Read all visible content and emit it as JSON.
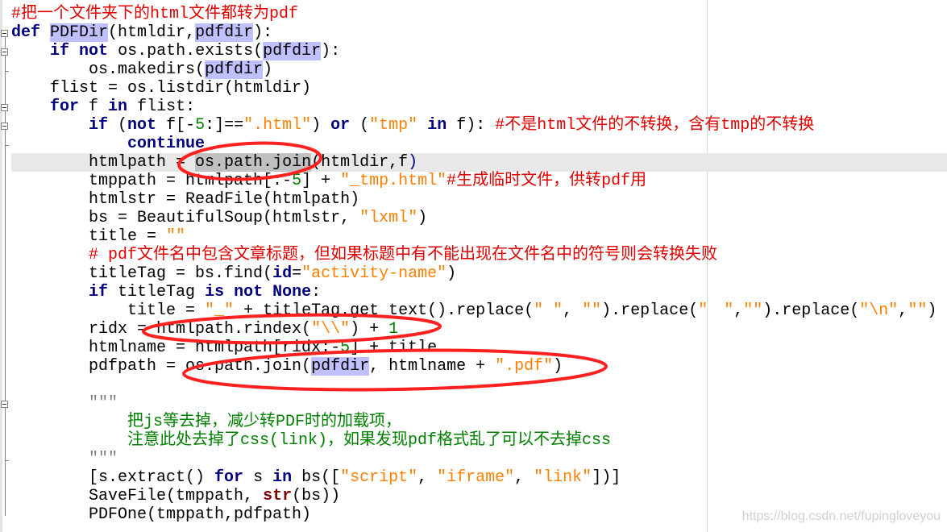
{
  "editor": {
    "current_line": 9,
    "colors": {
      "keyword": "#000080",
      "string": "#ff8000",
      "number": "#008000",
      "comment": "#e00000",
      "docstring": "#008000",
      "highlight": "#c0c0ff",
      "annotation": "#ff2020"
    },
    "lines": [
      [
        [
          "#把一个文件夹下的html文件都转为pdf",
          "c"
        ]
      ],
      [
        [
          "def",
          "k"
        ],
        [
          " ",
          ""
        ],
        [
          "PDFDir",
          "h"
        ],
        [
          "(htmldir,",
          ""
        ],
        [
          "pdfdir",
          "h"
        ],
        [
          "):",
          ""
        ]
      ],
      [
        [
          "    ",
          ""
        ],
        [
          "if",
          "k"
        ],
        [
          " ",
          ""
        ],
        [
          "not",
          "k"
        ],
        [
          " os.path.exists(",
          ""
        ],
        [
          "pdfdir",
          "h"
        ],
        [
          "):",
          ""
        ]
      ],
      [
        [
          "        os.makedirs(",
          ""
        ],
        [
          "pdfdir",
          "h"
        ],
        [
          ")",
          ""
        ]
      ],
      [
        [
          "    flist = os.listdir(htmldir)",
          ""
        ]
      ],
      [
        [
          "    ",
          ""
        ],
        [
          "for",
          "k"
        ],
        [
          " f ",
          ""
        ],
        [
          "in",
          "k"
        ],
        [
          " flist:",
          ""
        ]
      ],
      [
        [
          "        ",
          ""
        ],
        [
          "if",
          "k"
        ],
        [
          " (",
          ""
        ],
        [
          "not",
          "k"
        ],
        [
          " f[-",
          ""
        ],
        [
          "5",
          "n"
        ],
        [
          ":]==",
          ""
        ],
        [
          "\".html\"",
          "s"
        ],
        [
          ") ",
          ""
        ],
        [
          "or",
          "k"
        ],
        [
          " (",
          ""
        ],
        [
          "\"tmp\"",
          "s"
        ],
        [
          " ",
          ""
        ],
        [
          "in",
          "k"
        ],
        [
          " f): ",
          ""
        ],
        [
          "#不是html文件的不转换，含有tmp的不转换",
          "c"
        ]
      ],
      [
        [
          "            ",
          ""
        ],
        [
          "continue",
          "k"
        ]
      ],
      [
        [
          "        htmlpath = ",
          ""
        ],
        [
          "os.path.join",
          "sel"
        ],
        [
          "(htmldir,f",
          ""
        ],
        [
          ")",
          "f"
        ]
      ],
      [
        [
          "        tmppath = htmlpath[:-",
          ""
        ],
        [
          "5",
          "n"
        ],
        [
          "] + ",
          ""
        ],
        [
          "\"_tmp.html\"",
          "s"
        ],
        [
          "#生成临时文件，供转pdf用",
          "c"
        ]
      ],
      [
        [
          "        htmlstr = ReadFile(htmlpath)",
          ""
        ]
      ],
      [
        [
          "        bs = BeautifulSoup(htmlstr, ",
          ""
        ],
        [
          "\"lxml\"",
          "s"
        ],
        [
          ")",
          ""
        ]
      ],
      [
        [
          "        title = ",
          ""
        ],
        [
          "\"\"",
          "s"
        ]
      ],
      [
        [
          "        ",
          ""
        ],
        [
          "# pdf文件名中包含文章标题，但如果标题中有不能出现在文件名中的符号则会转换失败",
          "c"
        ]
      ],
      [
        [
          "        titleTag = bs.find(",
          ""
        ],
        [
          "id",
          "k"
        ],
        [
          "=",
          ""
        ],
        [
          "\"activity-name\"",
          "s"
        ],
        [
          ")",
          ""
        ]
      ],
      [
        [
          "        ",
          ""
        ],
        [
          "if",
          "k"
        ],
        [
          " titleTag ",
          ""
        ],
        [
          "is",
          "k"
        ],
        [
          " ",
          ""
        ],
        [
          "not",
          "k"
        ],
        [
          " ",
          ""
        ],
        [
          "None",
          "k"
        ],
        [
          ":",
          ""
        ]
      ],
      [
        [
          "            title = ",
          ""
        ],
        [
          "\"_\"",
          "s"
        ],
        [
          " + titleTag.get_text().replace(",
          ""
        ],
        [
          "\" \"",
          "s"
        ],
        [
          ", ",
          ""
        ],
        [
          "\"\"",
          "s"
        ],
        [
          ").replace(",
          ""
        ],
        [
          "\"　\"",
          "s"
        ],
        [
          ",",
          ""
        ],
        [
          "\"\"",
          "s"
        ],
        [
          ").replace(",
          ""
        ],
        [
          "\"\\n\"",
          "s"
        ],
        [
          ",",
          ""
        ],
        [
          "\"\"",
          "s"
        ],
        [
          ")",
          ""
        ]
      ],
      [
        [
          "        ridx = htmlpath.rindex(",
          ""
        ],
        [
          "\"\\\\\"",
          "s"
        ],
        [
          ") + ",
          ""
        ],
        [
          "1",
          "n"
        ]
      ],
      [
        [
          "        htmlname = htmlpath[ridx:-",
          ""
        ],
        [
          "5",
          "n"
        ],
        [
          "] + title",
          ""
        ]
      ],
      [
        [
          "        pdfpath = os.path.join(",
          ""
        ],
        [
          "pdfdir",
          "h"
        ],
        [
          ", htmlname + ",
          ""
        ],
        [
          "\".pdf\"",
          "s"
        ],
        [
          ")",
          ""
        ]
      ],
      [
        [
          "",
          ""
        ]
      ],
      [
        [
          "        ",
          ""
        ],
        [
          "\"\"\"",
          "q"
        ]
      ],
      [
        [
          "            把js等去掉，减少转PDF时的加载项，",
          "d"
        ]
      ],
      [
        [
          "            注意此处去掉了css(link)，如果发现pdf格式乱了可以不去掉css",
          "d"
        ]
      ],
      [
        [
          "        ",
          ""
        ],
        [
          "\"\"\"",
          "q"
        ]
      ],
      [
        [
          "        [s.extract() ",
          ""
        ],
        [
          "for",
          "k"
        ],
        [
          " s ",
          ""
        ],
        [
          "in",
          "k"
        ],
        [
          " bs([",
          ""
        ],
        [
          "\"script\"",
          "s"
        ],
        [
          ", ",
          ""
        ],
        [
          "\"iframe\"",
          "s"
        ],
        [
          ", ",
          ""
        ],
        [
          "\"link\"",
          "s"
        ],
        [
          "])]",
          ""
        ]
      ],
      [
        [
          "        SaveFile(tmppath, ",
          ""
        ],
        [
          "str",
          "b"
        ],
        [
          "(bs))",
          ""
        ]
      ],
      [
        [
          "        PDFOne(tmppath,pdfpath)",
          ""
        ]
      ]
    ]
  },
  "watermark": "https://blog.csdn.net/fupingloveyou"
}
